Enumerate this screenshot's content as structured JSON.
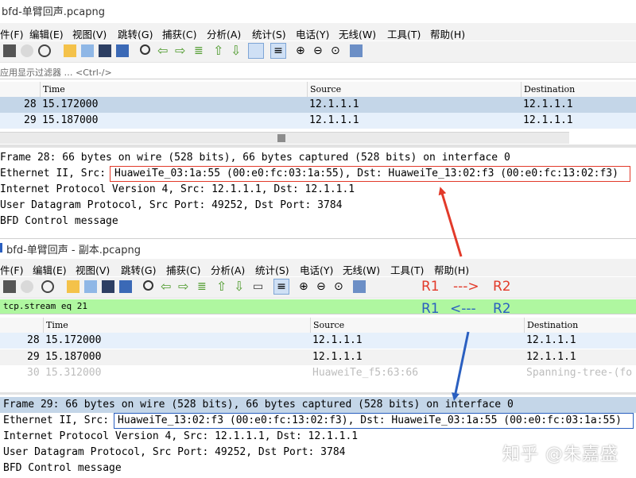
{
  "window1": {
    "title": "bfd-单臂回声.pcapng",
    "menu": [
      "件(F)",
      "编辑(E)",
      "视图(V)",
      "跳转(G)",
      "捕获(C)",
      "分析(A)",
      "统计(S)",
      "电话(Y)",
      "无线(W)",
      "工具(T)",
      "帮助(H)"
    ],
    "filter_placeholder": "应用显示过滤器 … <Ctrl-/>",
    "columns": {
      "time": "Time",
      "source": "Source",
      "destination": "Destination"
    },
    "rows": [
      {
        "no": "28",
        "time": "15.172000",
        "src": "12.1.1.1",
        "dst": "12.1.1.1"
      },
      {
        "no": "29",
        "time": "15.187000",
        "src": "12.1.1.1",
        "dst": "12.1.1.1"
      }
    ],
    "details": {
      "frame": "Frame 28: 66 bytes on wire (528 bits), 66 bytes captured (528 bits) on interface 0",
      "eth_prefix": "Ethernet II, Src: ",
      "eth_boxed": "HuaweiTe_03:1a:55 (00:e0:fc:03:1a:55), Dst: HuaweiTe_13:02:f3 (00:e0:fc:13:02:f3)",
      "ip": "Internet Protocol Version 4, Src: 12.1.1.1, Dst: 12.1.1.1",
      "udp": "User Datagram Protocol, Src Port: 49252, Dst Port: 3784",
      "bfd": "BFD Control message"
    }
  },
  "window2": {
    "title": "bfd-单臂回声 - 副本.pcapng",
    "menu": [
      "件(F)",
      "编辑(E)",
      "视图(V)",
      "跳转(G)",
      "捕获(C)",
      "分析(A)",
      "统计(S)",
      "电话(Y)",
      "无线(W)",
      "工具(T)",
      "帮助(H)"
    ],
    "filter_value": "tcp.stream eq 21",
    "columns": {
      "time": "Time",
      "source": "Source",
      "destination": "Destination"
    },
    "rows": [
      {
        "no": "28",
        "time": "15.172000",
        "src": "12.1.1.1",
        "dst": "12.1.1.1"
      },
      {
        "no": "29",
        "time": "15.187000",
        "src": "12.1.1.1",
        "dst": "12.1.1.1"
      },
      {
        "no": "30",
        "time": "15.312000",
        "src": "HuaweiTe_f5:63:66",
        "dst": "Spanning-tree-(fo"
      }
    ],
    "details": {
      "frame": "Frame 29: 66 bytes on wire (528 bits), 66 bytes captured (528 bits) on interface 0",
      "eth_prefix": "Ethernet II, Src: ",
      "eth_boxed": "HuaweiTe_13:02:f3 (00:e0:fc:13:02:f3), Dst: HuaweiTe_03:1a:55 (00:e0:fc:03:1a:55)",
      "ip": "Internet Protocol Version 4, Src: 12.1.1.1, Dst: 12.1.1.1",
      "udp": "User Datagram Protocol, Src Port: 49252, Dst Port: 3784",
      "bfd": "BFD Control message"
    }
  },
  "annotations": {
    "forward": {
      "a": "R1",
      "arrow": "--->",
      "b": "R2",
      "color": "#e23a2a"
    },
    "backward": {
      "a": "R1",
      "arrow": "<---",
      "b": "R2",
      "color": "#2a5fc0"
    }
  },
  "watermark": "知乎 @朱嘉盛",
  "colors": {
    "selected_row": "#c4d6e8",
    "light_row": "#e6f0fb",
    "filter_green": "#aff7a0",
    "annotation_red": "#e23a2a",
    "annotation_blue": "#2a5fc0"
  }
}
